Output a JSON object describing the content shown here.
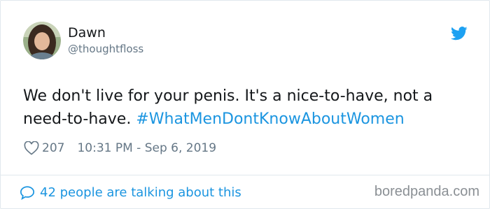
{
  "tweet": {
    "author": {
      "display_name": "Dawn",
      "handle": "@thoughtfloss",
      "avatar_icon": "profile-photo"
    },
    "text_plain": "We don't live for your penis. It's a nice-to-have, not a need-to-have.",
    "hashtag": "#WhatMenDontKnowAboutWomen",
    "likes": "207",
    "timestamp": "10:31 PM - Sep 6, 2019",
    "talking_about": "42 people are talking about this",
    "icons": {
      "brand": "twitter-bird-icon",
      "like": "heart-icon",
      "reply": "speech-bubble-icon"
    }
  },
  "watermark": "boredpanda.com",
  "colors": {
    "text": "#14171a",
    "secondary": "#657786",
    "link": "#1b95e0",
    "divider": "#e1e8ed",
    "watermark": "#8a8f94"
  }
}
